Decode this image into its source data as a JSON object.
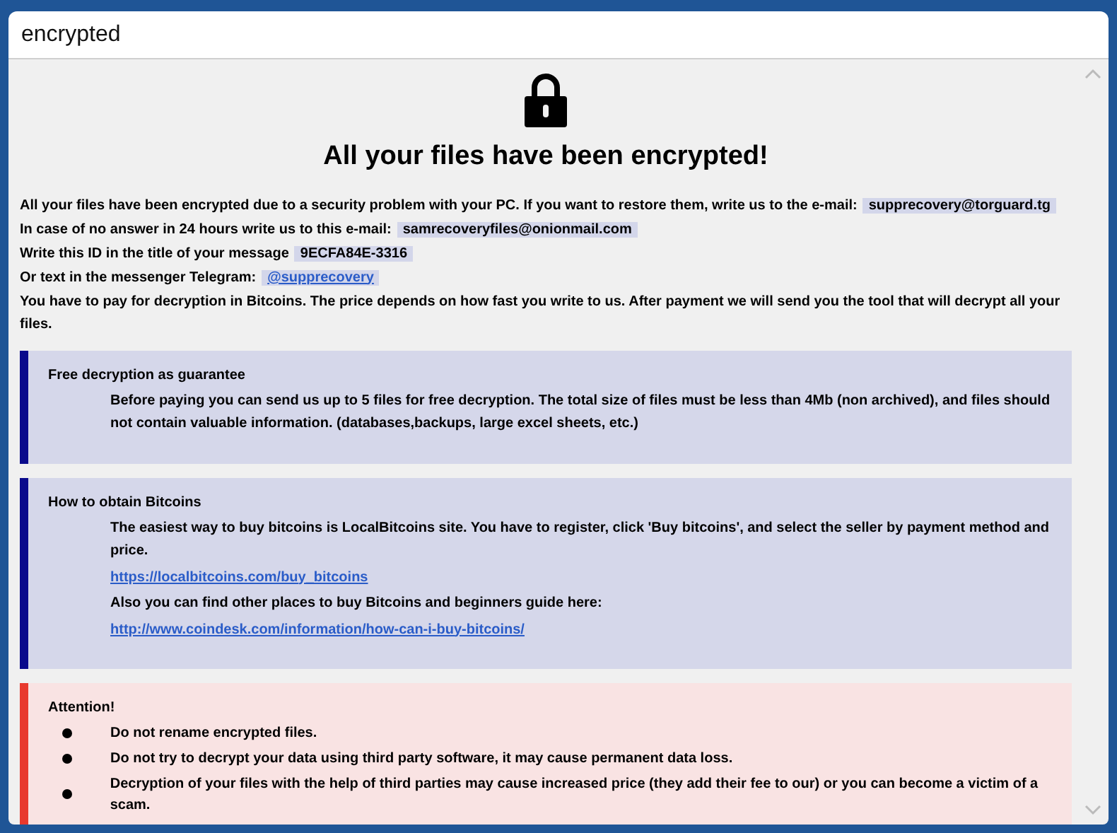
{
  "window": {
    "title": "encrypted"
  },
  "heading": "All your files have been encrypted!",
  "intro": [
    {
      "text": "All your files have been encrypted due to a security problem with your PC. If you want to restore them, write us to the e-mail:",
      "value": {
        "kind": "highlight",
        "text": "supprecovery@torguard.tg"
      }
    },
    {
      "text": "In case of no answer in 24 hours write us to this e-mail:",
      "value": {
        "kind": "highlight",
        "text": "samrecoveryfiles@onionmail.com"
      }
    },
    {
      "text": "Write this ID in the title of your message",
      "value": {
        "kind": "highlight",
        "text": "9ECFA84E-3316"
      }
    },
    {
      "text": "Or text in the messenger Telegram:",
      "value": {
        "kind": "link",
        "text": "@supprecovery"
      }
    },
    {
      "text": "You have to pay for decryption in Bitcoins. The price depends on how fast you write to us. After payment we will send you the tool that will decrypt all your files."
    }
  ],
  "sections": [
    {
      "kind": "info",
      "title": "Free decryption as guarantee",
      "items": [
        {
          "kind": "text",
          "text": "Before paying you can send us up to 5 files for free decryption. The total size of files must be less than 4Mb (non archived), and files should not contain valuable information. (databases,backups, large excel sheets, etc.)"
        }
      ]
    },
    {
      "kind": "info",
      "title": "How to obtain Bitcoins",
      "items": [
        {
          "kind": "text",
          "text": "The easiest way to buy bitcoins is LocalBitcoins site. You have to register, click 'Buy bitcoins', and select the seller by payment method and price."
        },
        {
          "kind": "link",
          "text": "https://localbitcoins.com/buy_bitcoins"
        },
        {
          "kind": "text",
          "text": "Also you can find other places to buy Bitcoins and beginners guide here:"
        },
        {
          "kind": "link",
          "text": "http://www.coindesk.com/information/how-can-i-buy-bitcoins/"
        }
      ]
    },
    {
      "kind": "warning",
      "title": "Attention!",
      "items": [
        {
          "kind": "bullet",
          "text": "Do not rename encrypted files."
        },
        {
          "kind": "bullet",
          "text": "Do not try to decrypt your data using third party software, it may cause permanent data loss."
        },
        {
          "kind": "bullet",
          "text": "Decryption of your files with the help of third parties may cause increased price (they add their fee to our) or you can become a victim of a scam."
        }
      ]
    }
  ]
}
